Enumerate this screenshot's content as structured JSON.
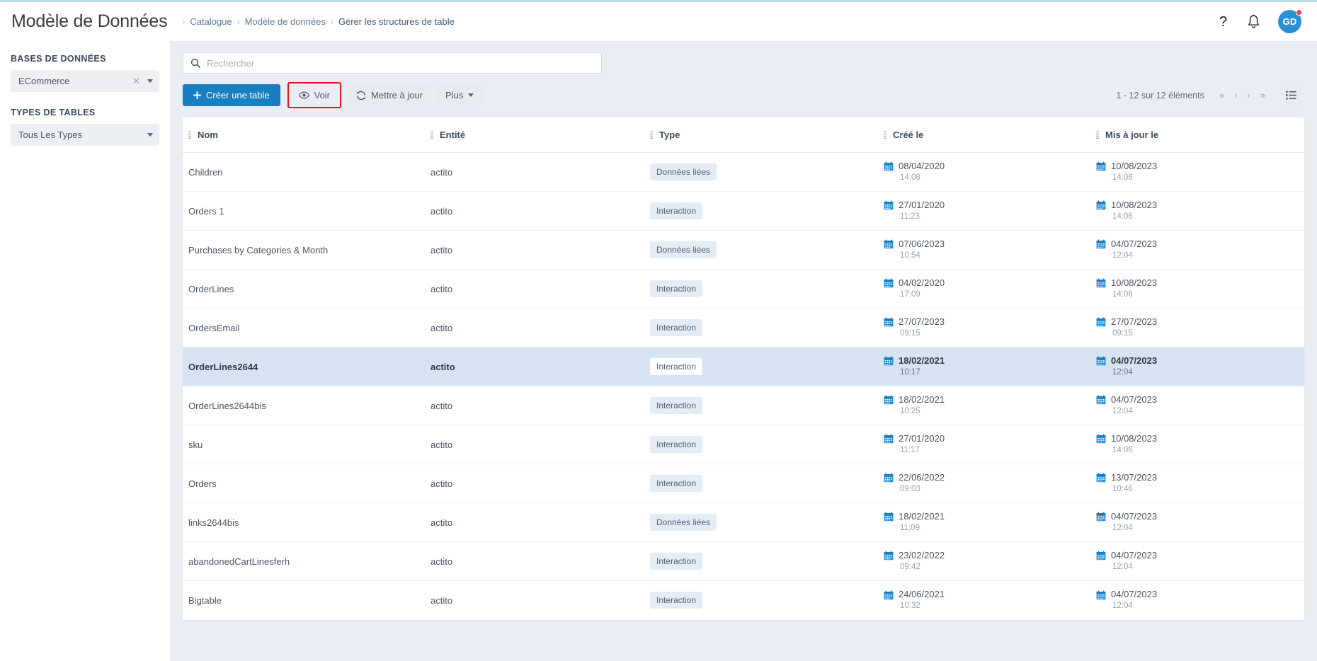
{
  "header": {
    "title": "Modèle de Données",
    "breadcrumb": [
      "Catalogue",
      "Modèle de données",
      "Gérer les structures de table"
    ],
    "icons": {
      "help": "help-icon",
      "bell": "bell-icon"
    },
    "avatar_initials": "GD"
  },
  "sidebar": {
    "databases_label": "BASES DE DONNÉES",
    "database_value": "ECommerce",
    "table_types_label": "TYPES DE TABLES",
    "table_types_value": "Tous Les Types"
  },
  "search": {
    "placeholder": "Rechercher",
    "value": ""
  },
  "toolbar": {
    "create_label": "Créer une table",
    "view_label": "Voir",
    "update_label": "Mettre à jour",
    "more_label": "Plus"
  },
  "pagination": {
    "count_text": "1 - 12 sur 12 éléments",
    "first": "«",
    "prev": "‹",
    "next": "›",
    "last": "»"
  },
  "table": {
    "columns": [
      "Nom",
      "Entité",
      "Type",
      "Créé le",
      "Mis à jour le"
    ],
    "rows": [
      {
        "nom": "Children",
        "entite": "actito",
        "type": "Données liées",
        "cree_date": "08/04/2020",
        "cree_time": "14:08",
        "maj_date": "10/08/2023",
        "maj_time": "14:06",
        "selected": false
      },
      {
        "nom": "Orders 1",
        "entite": "actito",
        "type": "Interaction",
        "cree_date": "27/01/2020",
        "cree_time": "11:23",
        "maj_date": "10/08/2023",
        "maj_time": "14:06",
        "selected": false
      },
      {
        "nom": "Purchases by Categories & Month",
        "entite": "actito",
        "type": "Données liées",
        "cree_date": "07/06/2023",
        "cree_time": "10:54",
        "maj_date": "04/07/2023",
        "maj_time": "12:04",
        "selected": false
      },
      {
        "nom": "OrderLines",
        "entite": "actito",
        "type": "Interaction",
        "cree_date": "04/02/2020",
        "cree_time": "17:09",
        "maj_date": "10/08/2023",
        "maj_time": "14:06",
        "selected": false
      },
      {
        "nom": "OrdersEmail",
        "entite": "actito",
        "type": "Interaction",
        "cree_date": "27/07/2023",
        "cree_time": "09:15",
        "maj_date": "27/07/2023",
        "maj_time": "09:15",
        "selected": false
      },
      {
        "nom": "OrderLines2644",
        "entite": "actito",
        "type": "Interaction",
        "cree_date": "18/02/2021",
        "cree_time": "10:17",
        "maj_date": "04/07/2023",
        "maj_time": "12:04",
        "selected": true
      },
      {
        "nom": "OrderLines2644bis",
        "entite": "actito",
        "type": "Interaction",
        "cree_date": "18/02/2021",
        "cree_time": "10:25",
        "maj_date": "04/07/2023",
        "maj_time": "12:04",
        "selected": false
      },
      {
        "nom": "sku",
        "entite": "actito",
        "type": "Interaction",
        "cree_date": "27/01/2020",
        "cree_time": "11:17",
        "maj_date": "10/08/2023",
        "maj_time": "14:06",
        "selected": false
      },
      {
        "nom": "Orders",
        "entite": "actito",
        "type": "Interaction",
        "cree_date": "22/06/2022",
        "cree_time": "09:03",
        "maj_date": "13/07/2023",
        "maj_time": "10:46",
        "selected": false
      },
      {
        "nom": "links2644bis",
        "entite": "actito",
        "type": "Données liées",
        "cree_date": "18/02/2021",
        "cree_time": "11:09",
        "maj_date": "04/07/2023",
        "maj_time": "12:04",
        "selected": false
      },
      {
        "nom": "abandonedCartLinesferh",
        "entite": "actito",
        "type": "Interaction",
        "cree_date": "23/02/2022",
        "cree_time": "09:42",
        "maj_date": "04/07/2023",
        "maj_time": "12:04",
        "selected": false
      },
      {
        "nom": "Bigtable",
        "entite": "actito",
        "type": "Interaction",
        "cree_date": "24/06/2021",
        "cree_time": "10:32",
        "maj_date": "04/07/2023",
        "maj_time": "12:04",
        "selected": false
      }
    ]
  },
  "colors": {
    "accent_blue": "#1a7fc1",
    "selected_row": "#d6e4f2",
    "badge_bg": "#e4ecf6",
    "highlight_border": "#e8131b",
    "avatar_bg": "#2b8fd4",
    "notification_dot": "#f4414e",
    "main_bg": "#eaeef4"
  }
}
